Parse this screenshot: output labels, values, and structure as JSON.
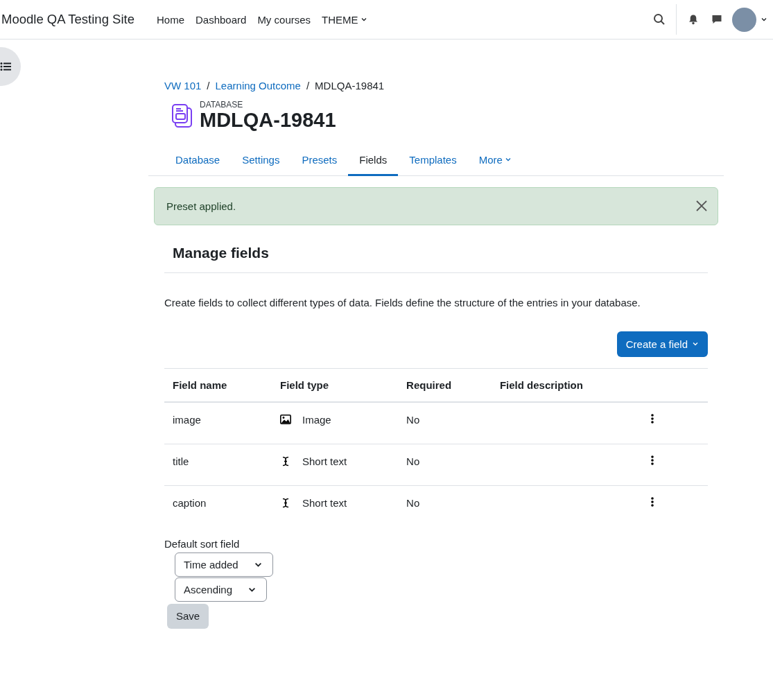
{
  "navbar": {
    "site_name": "Moodle QA Testing Site",
    "menu": [
      {
        "label": "Home",
        "dropdown": false
      },
      {
        "label": "Dashboard",
        "dropdown": false
      },
      {
        "label": "My courses",
        "dropdown": false
      },
      {
        "label": "THEME",
        "dropdown": true
      }
    ]
  },
  "breadcrumb": [
    {
      "label": "VW 101",
      "link": true
    },
    {
      "separator": "/",
      "label": "Learning Outcome",
      "link": true
    },
    {
      "separator": "/",
      "label": "MDLQA-19841",
      "link": false
    }
  ],
  "header": {
    "module_type": "DATABASE",
    "title": "MDLQA-19841"
  },
  "tabs": [
    {
      "label": "Database",
      "selected": false,
      "dropdown": false
    },
    {
      "label": "Settings",
      "selected": false,
      "dropdown": false
    },
    {
      "label": "Presets",
      "selected": false,
      "dropdown": false
    },
    {
      "label": "Fields",
      "selected": true,
      "dropdown": false
    },
    {
      "label": "Templates",
      "selected": false,
      "dropdown": false
    },
    {
      "label": "More",
      "selected": false,
      "dropdown": true
    }
  ],
  "alert": {
    "message": "Preset applied."
  },
  "section": {
    "heading": "Manage fields",
    "description": "Create fields to collect different types of data. Fields define the structure of the entries in your database.",
    "create_button": "Create a field"
  },
  "table": {
    "columns": [
      "Field name",
      "Field type",
      "Required",
      "Field description"
    ],
    "rows": [
      {
        "name": "image",
        "type": "Image",
        "kind": "image",
        "required": "No"
      },
      {
        "name": "title",
        "type": "Short text",
        "kind": "text",
        "required": "No"
      },
      {
        "name": "caption",
        "type": "Short text",
        "kind": "text",
        "required": "No"
      }
    ]
  },
  "sort": {
    "label": "Default sort field",
    "field": "Time added",
    "order": "Ascending",
    "save": "Save"
  }
}
